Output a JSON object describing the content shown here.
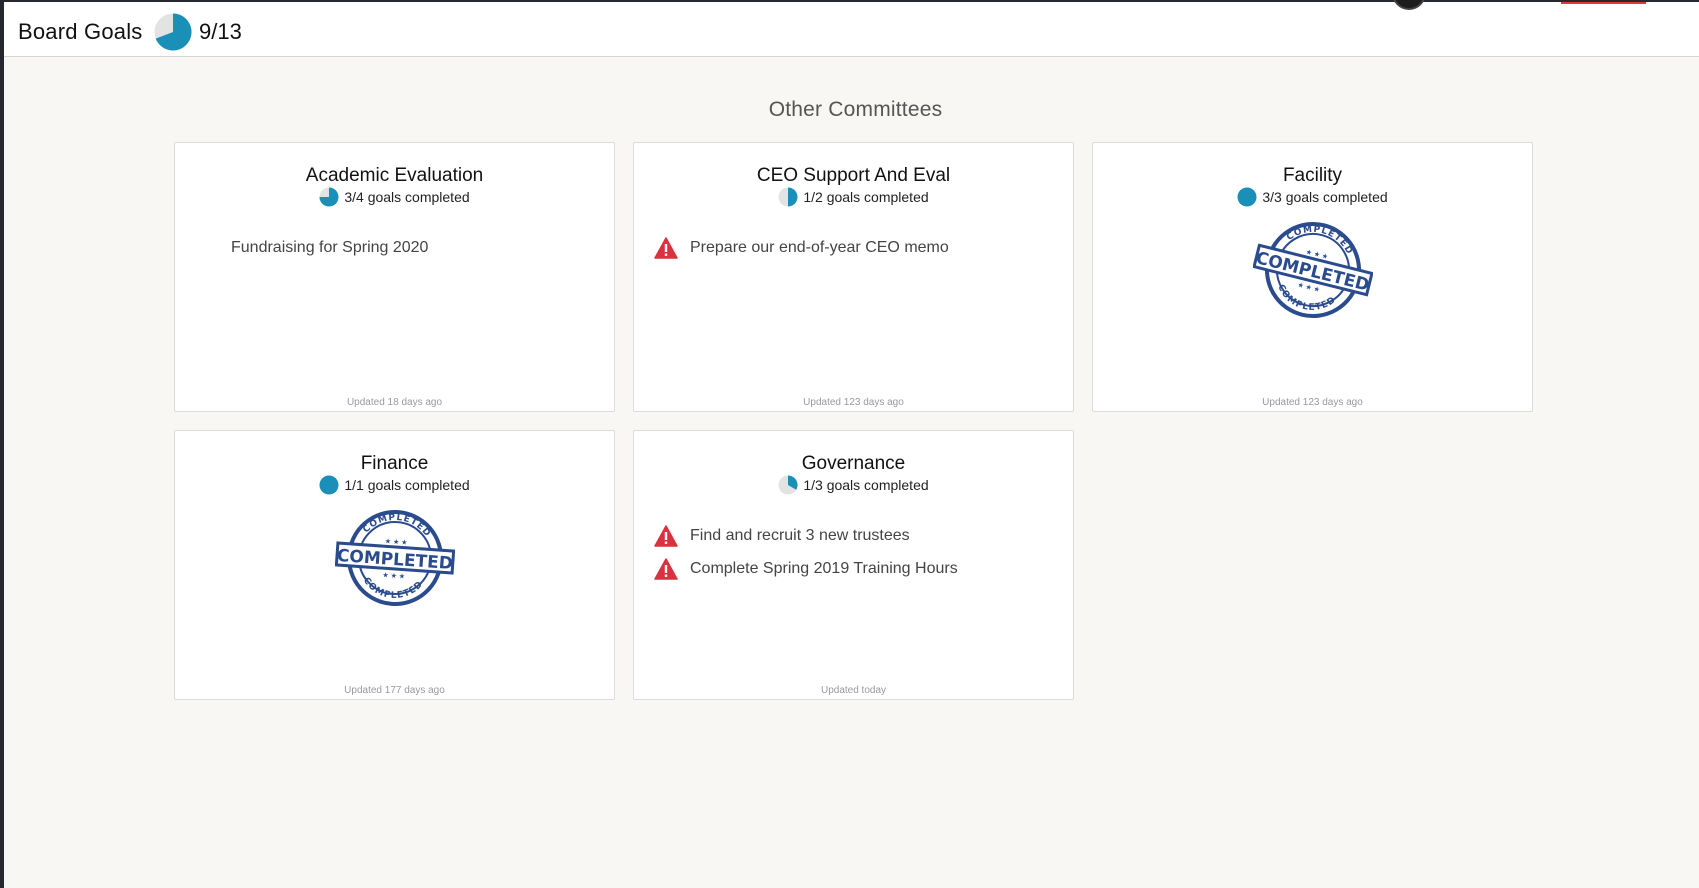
{
  "header": {
    "title": "Board Goals",
    "completed_count": "9/13",
    "completed_fraction": 0.6923
  },
  "section": {
    "title": "Other Committees"
  },
  "committees": [
    {
      "name": "Academic Evaluation",
      "progress_text": "3/4 goals completed",
      "progress_fraction": 0.75,
      "open_goals": [
        {
          "text": "Fundraising for Spring 2020",
          "status": "none"
        }
      ],
      "updated": "Updated 18 days ago"
    },
    {
      "name": "CEO Support And Eval",
      "progress_text": "1/2 goals completed",
      "progress_fraction": 0.5,
      "open_goals": [
        {
          "text": "Prepare our end-of-year CEO memo",
          "status": "warning"
        }
      ],
      "updated": "Updated 123 days ago"
    },
    {
      "name": "Facility",
      "progress_text": "3/3 goals completed",
      "progress_fraction": 1.0,
      "stamp": {
        "main": "COMPLETED",
        "ring_top": "COMPLETED",
        "ring_bottom": "COMPLETED"
      },
      "updated": "Updated 123 days ago"
    },
    {
      "name": "Finance",
      "progress_text": "1/1 goals completed",
      "progress_fraction": 1.0,
      "stamp": {
        "main": "COMPLETED",
        "ring_top": "COMPLETED",
        "ring_bottom": "COMPLETED"
      },
      "updated": "Updated 177 days ago"
    },
    {
      "name": "Governance",
      "progress_text": "1/3 goals completed",
      "progress_fraction": 0.3333,
      "open_goals": [
        {
          "text": "Find and recruit 3 new trustees",
          "status": "warning"
        },
        {
          "text": "Complete Spring 2019 Training Hours",
          "status": "warning"
        }
      ],
      "updated": "Updated today"
    }
  ],
  "colors": {
    "accent": "#1a8fb8",
    "pie_track": "#e3e3e3",
    "warning": "#d9323e",
    "stamp": "#2a4b8d"
  },
  "icons": {
    "warning": "warning-triangle-icon",
    "progress": "progress-pie-icon",
    "stamp": "completed-stamp-icon"
  }
}
